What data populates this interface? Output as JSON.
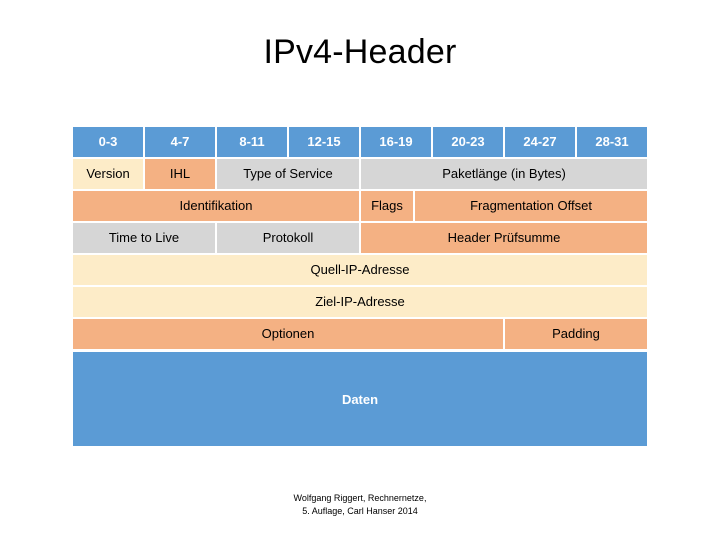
{
  "slide": {
    "title": "IPv4-Header"
  },
  "colors": {
    "bit_header": "#5b9bd5",
    "gray_field": "#d6d6d6",
    "orange_field": "#f4b183",
    "cream_field": "#fdecc8",
    "data_block": "#5b9bd5",
    "gap": "#ffffff",
    "text": "#000000",
    "text_inverse": "#ffffff"
  },
  "bit_header": {
    "labels": [
      "0-3",
      "4-7",
      "8-11",
      "12-15",
      "16-19",
      "20-23",
      "24-27",
      "28-31"
    ]
  },
  "rows": [
    {
      "name": "row-1",
      "cells": [
        {
          "label": "Version",
          "span": 1,
          "color": "cream"
        },
        {
          "label": "IHL",
          "span": 1,
          "color": "orange"
        },
        {
          "label": "Type of Service",
          "span": 2,
          "color": "gray"
        },
        {
          "label": "Paketlänge (in Bytes)",
          "span": 4,
          "color": "gray"
        }
      ]
    },
    {
      "name": "row-2",
      "cells": [
        {
          "label": "Identifikation",
          "span": 4,
          "color": "orange"
        },
        {
          "label": "Flags",
          "span": 0.75,
          "color": "orange"
        },
        {
          "label": "Fragmentation Offset",
          "span": 3.25,
          "color": "orange"
        }
      ]
    },
    {
      "name": "row-3",
      "cells": [
        {
          "label": "Time to Live",
          "span": 2,
          "color": "gray"
        },
        {
          "label": "Protokoll",
          "span": 2,
          "color": "gray"
        },
        {
          "label": "Header Prüfsumme",
          "span": 4,
          "color": "orange"
        }
      ]
    },
    {
      "name": "row-4",
      "cells": [
        {
          "label": "Quell-IP-Adresse",
          "span": 8,
          "color": "cream"
        }
      ]
    },
    {
      "name": "row-5",
      "cells": [
        {
          "label": "Ziel-IP-Adresse",
          "span": 8,
          "color": "cream"
        }
      ]
    },
    {
      "name": "row-6",
      "cells": [
        {
          "label": "Optionen",
          "span": 6,
          "color": "orange"
        },
        {
          "label": "Padding",
          "span": 2,
          "color": "orange"
        }
      ]
    }
  ],
  "data_block": {
    "label": "Daten"
  },
  "source_note": {
    "line1": "Wolfgang Riggert, Rechnernetze,",
    "line2": "5. Auflage, Carl Hanser 2014"
  }
}
